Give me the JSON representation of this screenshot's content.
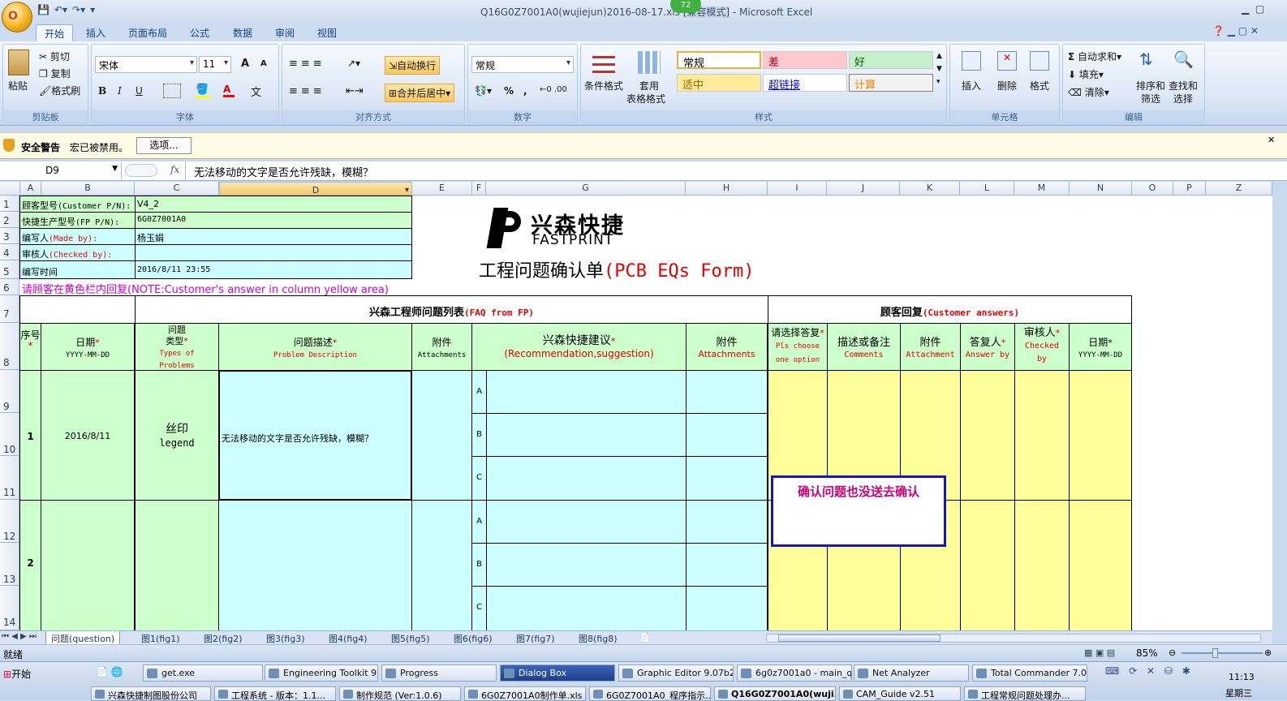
{
  "window": {
    "title": "Q16G0Z7001A0(wujiejun)2016-08-17.xls",
    "mode": "[兼容模式]",
    "app": "Microsoft Excel",
    "badge": "72"
  },
  "office_button": "O",
  "ribbon_tabs": [
    "开始",
    "插入",
    "页面布局",
    "公式",
    "数据",
    "审阅",
    "视图"
  ],
  "ribbon": {
    "clipboard": {
      "paste": "粘贴",
      "cut": "剪切",
      "copy": "复制",
      "format_painter": "格式刷",
      "label": "剪贴板"
    },
    "font": {
      "name": "宋体",
      "size": "11",
      "grow": "A",
      "shrink": "A",
      "label": "字体",
      "bold": "B",
      "italic": "I",
      "underline": "U",
      "wen": "文"
    },
    "align": {
      "wrap": "自动换行",
      "merge": "合并后居中",
      "label": "对齐方式"
    },
    "number": {
      "format": "常规",
      "percent": "%",
      "comma": ",",
      "label": "数字"
    },
    "styles": {
      "cond": "条件格式",
      "table1": "套用",
      "table2": "表格格式",
      "cells": [
        {
          "text": "常规",
          "bg": "#ffffff",
          "color": "#000000"
        },
        {
          "text": "差",
          "bg": "#ffc7ce",
          "color": "#9c0006"
        },
        {
          "text": "好",
          "bg": "#c6efce",
          "color": "#006100"
        },
        {
          "text": "适中",
          "bg": "#ffeb9c",
          "color": "#9c6500"
        },
        {
          "text": "超链接",
          "bg": "#ffffff",
          "color": "#0000ff"
        },
        {
          "text": "计算",
          "bg": "#f2f2f2",
          "color": "#fa7d00"
        }
      ],
      "label": "样式"
    },
    "cellsgrp": {
      "insert": "插入",
      "delete": "删除",
      "format": "格式",
      "label": "单元格"
    },
    "editing": {
      "autosum": "自动求和",
      "fill": "填充",
      "clear": "清除",
      "sort1": "排序和",
      "sort2": "筛选",
      "find1": "查找和",
      "find2": "选择",
      "label": "编辑"
    }
  },
  "security": {
    "title": "安全警告",
    "msg": "宏已被禁用。",
    "btn": "选项..."
  },
  "formula": {
    "cell": "D9",
    "fx": "fx",
    "value": "无法移动的文字是否允许残缺，模糊？"
  },
  "columns": [
    "A",
    "B",
    "C",
    "D",
    "E",
    "F",
    "G",
    "H",
    "I",
    "J",
    "K",
    "L",
    "M",
    "N",
    "O",
    "P",
    "Z"
  ],
  "rows": [
    "1",
    "2",
    "3",
    "4",
    "5",
    "6",
    "7",
    "8",
    "9",
    "10",
    "11",
    "12",
    "13",
    "14"
  ],
  "header_info": [
    {
      "label": "顾客型号",
      "label_en": "(Customer P/N):",
      "value": "V4_2"
    },
    {
      "label": "快捷生产型号",
      "label_en": "(FP P/N):",
      "value": "6G0Z7001A0"
    },
    {
      "label": "编写人",
      "label_en": "(Made by):",
      "value": "杨玉娟"
    },
    {
      "label": "审核人",
      "label_en": "(Checked by):",
      "value": ""
    },
    {
      "label": "编写时间",
      "label_en": "",
      "value": "2016/8/11 23:55"
    }
  ],
  "note": {
    "cn": "请顾客在黄色栏内回复",
    "en": "(NOTE:Customer's answer in column yellow area)"
  },
  "logo": {
    "cn": "兴森快捷",
    "en": "FASTPRINT"
  },
  "form_title": {
    "cn": "工程问题确认单",
    "en": "(PCB EQs Form)"
  },
  "sections": {
    "faq_cn": "兴森工程师问题列表",
    "faq_en": "(FAQ from FP)",
    "cust_cn": "顾客回复",
    "cust_en": "(Customer answers)"
  },
  "headers": {
    "seq": "序号",
    "date": "日期",
    "date_fmt": "YYYY-MM-DD",
    "type_cn": "问题",
    "type_cn2": "类型",
    "type_en": "Types of",
    "type_en2": "Problems",
    "desc_cn": "问题描述",
    "desc_en": "Problem Description",
    "att_cn": "附件",
    "att_en": "Attachments",
    "rec_cn": "兴森快捷建议",
    "rec_en": "(Recommendation,suggestion)",
    "att2_cn": "附件",
    "att2_en": "Attachments",
    "choose_cn": "请选择答复",
    "choose_en": "Pls choose",
    "choose_en2": "one option",
    "cmt_cn": "描述或备注",
    "cmt_en": "Comments",
    "att3_cn": "附件",
    "att3_en": "Attachment",
    "ans_cn": "答复人",
    "ans_en": "Answer by",
    "chk_cn": "审核人",
    "chk_en": "Checked",
    "chk_en2": "by",
    "date2": "日期",
    "star": "*"
  },
  "items": [
    {
      "no": "1",
      "date": "2016/8/11",
      "type_cn": "丝印",
      "type_en": "legend",
      "desc": "无法移动的文字是否允许残缺，模糊？",
      "options": [
        "A",
        "B",
        "C"
      ]
    },
    {
      "no": "2",
      "date": "",
      "type_cn": "",
      "type_en": "",
      "desc": "",
      "options": [
        "A",
        "B",
        "C"
      ]
    }
  ],
  "callout": "确认问题也没送去确认",
  "sheet_tabs": [
    "问题(question)",
    "图1(fig1)",
    "图2(fig2)",
    "图3(fig3)",
    "图4(fig4)",
    "图5(fig5)",
    "图6(fig6)",
    "图7(fig7)",
    "图8(fig8)"
  ],
  "status": {
    "ready": "就绪",
    "zoom": "85%"
  },
  "taskbar": {
    "start": "开始",
    "row1": [
      "get.exe",
      "Engineering Toolkit 9....",
      "Progress",
      "Dialog Box",
      "Graphic Editor 9.07b2 ...",
      "6g0z7001a0 - main_qa",
      "Net Analyzer",
      "Total Commander 7.0 ..."
    ],
    "row2": [
      "兴森快捷制图股份公司",
      "工程系统 - 版本：1.1...",
      "制作规范 (Ver:1.0.6)",
      "6G0Z7001A0制作单.xls",
      "6G0Z7001A0_程序指示...",
      "Q16G0Z7001A0(wuji...",
      "CAM_Guide v2.51",
      "工程常规问题处理办..."
    ],
    "time": "11:13",
    "day": "星期三"
  }
}
